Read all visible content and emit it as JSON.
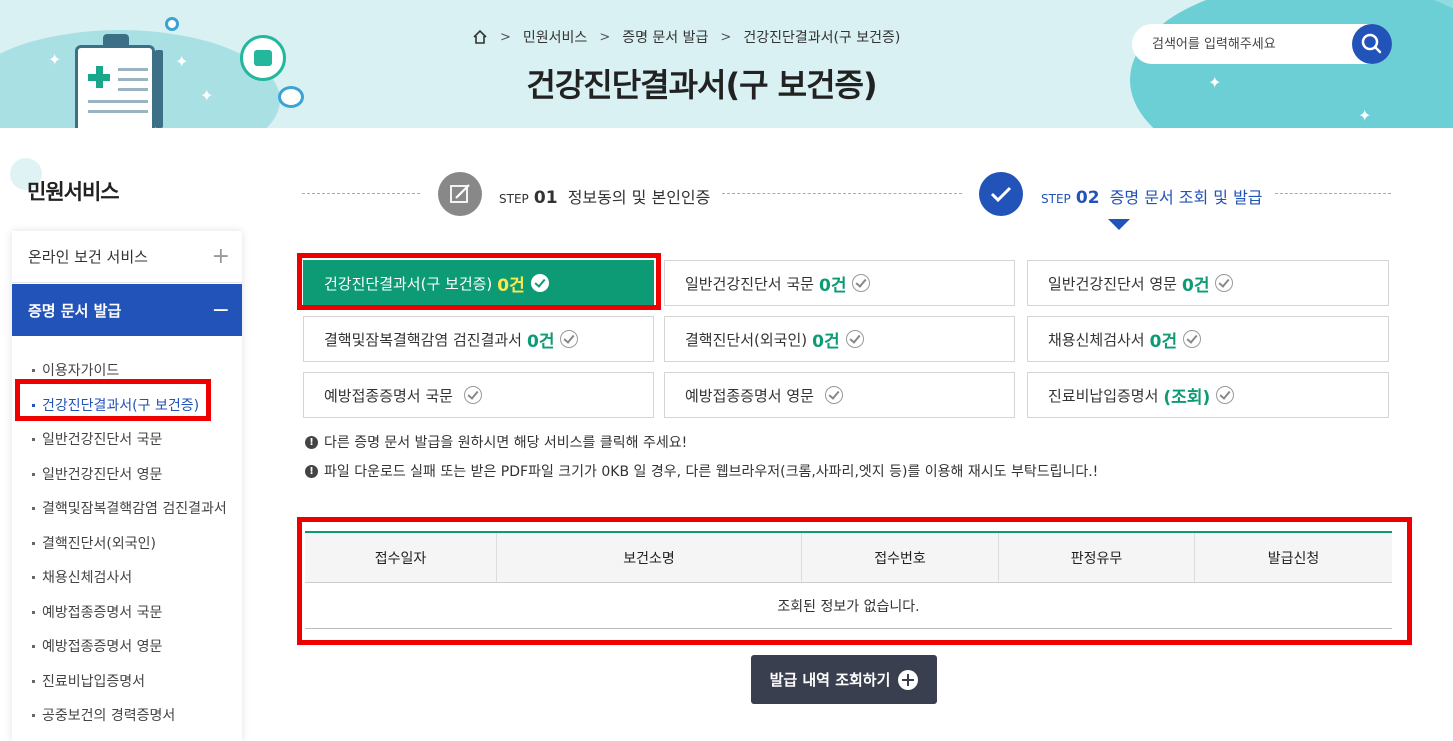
{
  "header": {
    "breadcrumb": [
      "민원서비스",
      "증명 문서 발급",
      "건강진단결과서(구 보건증)"
    ],
    "page_title": "건강진단결과서(구 보건증)",
    "search_placeholder": "검색어를 입력해주세요"
  },
  "sidebar": {
    "title": "민원서비스",
    "sections": [
      {
        "label": "온라인 보건 서비스",
        "toggle": "+"
      },
      {
        "label": "증명 문서 발급",
        "toggle": "−"
      }
    ],
    "items": [
      {
        "label": "이용자가이드"
      },
      {
        "label": "건강진단결과서(구 보건증)"
      },
      {
        "label": "일반건강진단서 국문"
      },
      {
        "label": "일반건강진단서 영문"
      },
      {
        "label": "결핵및잠복결핵감염 검진결과서"
      },
      {
        "label": "결핵진단서(외국인)"
      },
      {
        "label": "채용신체검사서"
      },
      {
        "label": "예방접종증명서 국문"
      },
      {
        "label": "예방접종증명서 영문"
      },
      {
        "label": "진료비납입증명서"
      },
      {
        "label": "공중보건의 경력증명서"
      }
    ]
  },
  "steps": [
    {
      "prefix": "STEP",
      "num": "01",
      "label": "정보동의 및 본인인증"
    },
    {
      "prefix": "STEP",
      "num": "02",
      "label": "증명 문서 조회 및 발급"
    }
  ],
  "documents": [
    {
      "label": "건강진단결과서(구 보건증)",
      "count": "0건"
    },
    {
      "label": "일반건강진단서 국문",
      "count": "0건"
    },
    {
      "label": "일반건강진단서 영문",
      "count": "0건"
    },
    {
      "label": "결핵및잠복결핵감염 검진결과서",
      "count": "0건"
    },
    {
      "label": "결핵진단서(외국인)",
      "count": "0건"
    },
    {
      "label": "채용신체검사서",
      "count": "0건"
    },
    {
      "label": "예방접종증명서 국문",
      "count": ""
    },
    {
      "label": "예방접종증명서 영문",
      "count": ""
    },
    {
      "label": "진료비납입증명서",
      "count": "(조회)"
    }
  ],
  "notes": [
    "다른 증명 문서 발급을 원하시면 해당 서비스를 클릭해 주세요!",
    "파일 다운로드 실패 또는 받은 PDF파일 크기가 0KB 일 경우, 다른 웹브라우저(크롬,사파리,엣지 등)를 이용해 재시도 부탁드립니다.!"
  ],
  "table": {
    "headers": [
      "접수일자",
      "보건소명",
      "접수번호",
      "판정유무",
      "발급신청"
    ],
    "empty_message": "조회된 정보가 없습니다."
  },
  "more_button": "발급 내역 조회하기",
  "colors": {
    "accent_blue": "#2253b8",
    "accent_green": "#0d9b76",
    "highlight_red": "#ee0000"
  }
}
